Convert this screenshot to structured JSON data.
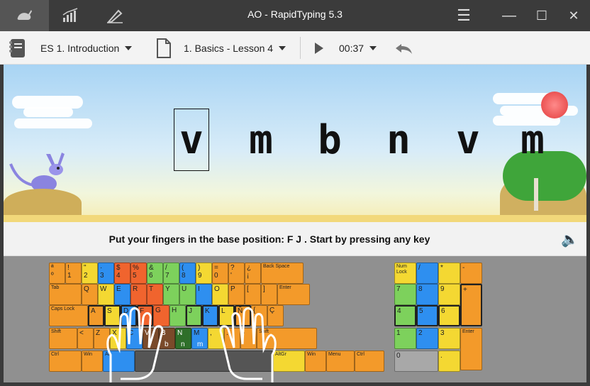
{
  "window": {
    "title": "AO - RapidTyping 5.3",
    "nav_icons": [
      "rabbit-icon",
      "stats-icon",
      "editor-icon"
    ],
    "controls": [
      "menu-icon",
      "minimize-icon",
      "maximize-icon",
      "close-icon"
    ]
  },
  "toolbar": {
    "course": "ES 1. Introduction",
    "lesson": "1. Basics - Lesson 4",
    "timer": "00:37"
  },
  "lesson": {
    "letters": [
      "v",
      "m",
      "b",
      "n",
      "v",
      "m"
    ],
    "current_index": 0,
    "instruction": "Put your fingers in the base position:  F  J .  Start by pressing any key"
  },
  "keyboard": {
    "row0": [
      {
        "t": "ª",
        "b": "º",
        "c": "ko"
      },
      {
        "t": "!",
        "b": "1",
        "c": "ko"
      },
      {
        "t": "\"",
        "b": "2",
        "c": "ky"
      },
      {
        "t": "·",
        "b": "3",
        "c": "kb"
      },
      {
        "t": "$",
        "b": "4",
        "c": "kr"
      },
      {
        "t": "%",
        "b": "5",
        "c": "kr"
      },
      {
        "t": "&",
        "b": "6",
        "c": "kg"
      },
      {
        "t": "/",
        "b": "7",
        "c": "kg"
      },
      {
        "t": "(",
        "b": "8",
        "c": "kb"
      },
      {
        "t": ")",
        "b": "9",
        "c": "ky"
      },
      {
        "t": "=",
        "b": "0",
        "c": "ko"
      },
      {
        "t": "?",
        "b": "'",
        "c": "ko"
      },
      {
        "t": "¿",
        "b": "¡",
        "c": "ko"
      },
      {
        "t": "Back Space",
        "b": "",
        "c": "ko"
      }
    ],
    "row1": [
      "Tab",
      "Q",
      "W",
      "E",
      "R",
      "T",
      "Y",
      "U",
      "I",
      "O",
      "P",
      "[",
      "]",
      "Enter"
    ],
    "row2": [
      "Caps Lock",
      "A",
      "S",
      "D",
      "F",
      "G",
      "H",
      "J",
      "K",
      "L",
      "Ñ",
      "{",
      "Ç"
    ],
    "row3": [
      "Shift",
      "<",
      "Z",
      "X",
      "C",
      "V",
      "B",
      "N",
      "M",
      ",",
      ".",
      "-",
      "Shift"
    ],
    "row4": [
      "Ctrl",
      "Win",
      "Alt",
      "",
      "AltGr",
      "Win",
      "Menu",
      "Ctrl"
    ],
    "hand_keys": [
      "v",
      "b",
      "n",
      "m"
    ],
    "numpad": {
      "numlock": "Num Lock",
      "keys": [
        "/",
        "*",
        "-",
        "7",
        "8",
        "9",
        "+",
        "4",
        "5",
        "6",
        "1",
        "2",
        "3",
        "Enter",
        "0",
        "."
      ]
    }
  }
}
